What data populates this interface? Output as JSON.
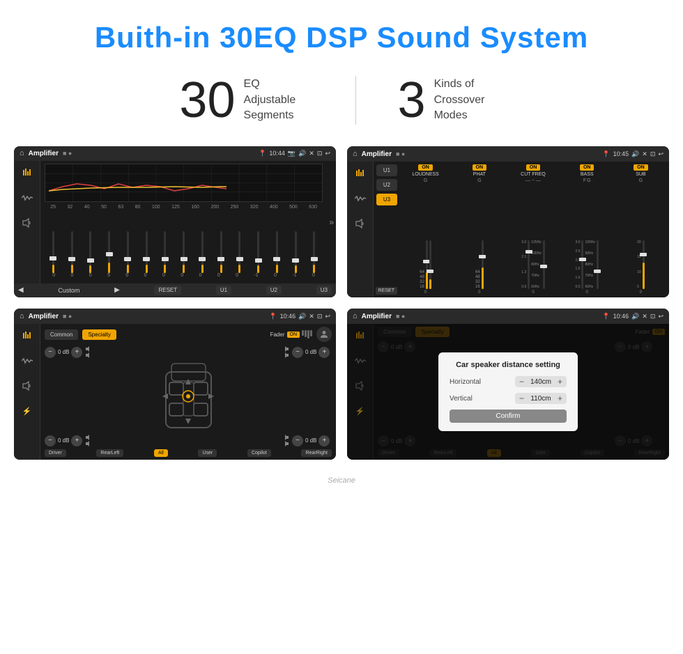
{
  "page": {
    "title": "Buith-in 30EQ DSP Sound System",
    "stat1_number": "30",
    "stat1_text_line1": "EQ Adjustable",
    "stat1_text_line2": "Segments",
    "stat2_number": "3",
    "stat2_text_line1": "Kinds of",
    "stat2_text_line2": "Crossover Modes",
    "watermark": "Seicane"
  },
  "screen1": {
    "title": "Amplifier",
    "time": "10:44",
    "preset": "Custom",
    "freq_labels": [
      "25",
      "32",
      "40",
      "50",
      "63",
      "80",
      "100",
      "125",
      "160",
      "200",
      "250",
      "320",
      "400",
      "500",
      "630"
    ],
    "values": [
      "0",
      "0",
      "0",
      "5",
      "0",
      "0",
      "0",
      "0",
      "0",
      "0",
      "0",
      "-1",
      "0",
      "-1"
    ],
    "buttons": [
      "RESET",
      "U1",
      "U2",
      "U3"
    ]
  },
  "screen2": {
    "title": "Amplifier",
    "time": "10:45",
    "presets": [
      "U1",
      "U2",
      "U3"
    ],
    "active_preset": "U3",
    "channels": [
      {
        "name": "LOUDNESS",
        "on": true,
        "sub": "G"
      },
      {
        "name": "PHAT",
        "on": true,
        "sub": "G"
      },
      {
        "name": "CUT FREQ",
        "on": true,
        "sub": "F G"
      },
      {
        "name": "BASS",
        "on": true,
        "sub": "F G"
      },
      {
        "name": "SUB",
        "on": true,
        "sub": "G"
      }
    ],
    "reset_label": "RESET"
  },
  "screen3": {
    "title": "Amplifier",
    "time": "10:46",
    "presets": [
      "Common",
      "Specialty"
    ],
    "active_preset": "Specialty",
    "fader_label": "Fader",
    "fader_on": "ON",
    "vol_rows": [
      {
        "label": "0 dB",
        "side": "left"
      },
      {
        "label": "0 dB",
        "side": "left"
      },
      {
        "label": "0 dB",
        "side": "right"
      },
      {
        "label": "0 dB",
        "side": "right"
      }
    ],
    "bottom_btns": [
      "Driver",
      "RearLeft",
      "All",
      "User",
      "Copilot",
      "RearRight"
    ],
    "active_btn": "All"
  },
  "screen4": {
    "title": "Amplifier",
    "time": "10:46",
    "presets": [
      "Common",
      "Specialty"
    ],
    "active_preset": "Specialty",
    "fader_on": "ON",
    "dialog": {
      "title": "Car speaker distance setting",
      "horizontal_label": "Horizontal",
      "horizontal_value": "140cm",
      "vertical_label": "Vertical",
      "vertical_value": "110cm",
      "confirm_label": "Confirm"
    },
    "bottom_btns": [
      "Driver",
      "RearLeft",
      "All",
      "User",
      "Copilot",
      "RearRight"
    ]
  },
  "icons": {
    "home": "⌂",
    "back": "↩",
    "location": "📍",
    "camera": "📷",
    "volume": "🔊",
    "close_x": "✕",
    "expand": "⊡",
    "eq": "≡",
    "waveform": "〜",
    "speaker": "🔉",
    "chevron_right": "»",
    "play": "▶",
    "back_arrow": "◀",
    "minus": "−",
    "plus": "+"
  }
}
